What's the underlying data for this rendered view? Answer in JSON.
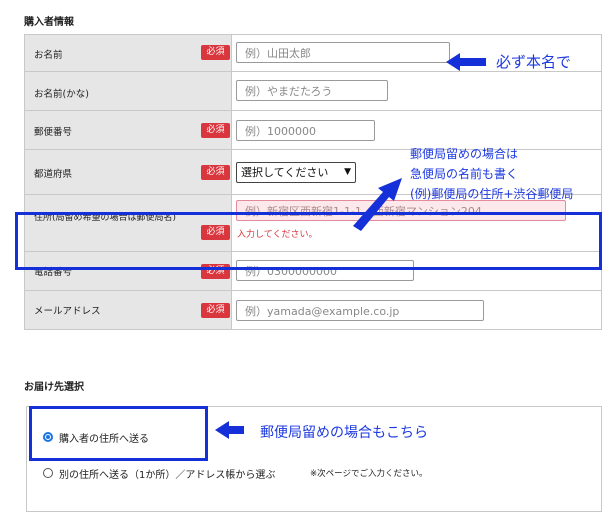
{
  "colors": {
    "required_badge": "#d9363e",
    "annotation": "#1d39e0",
    "label_bg": "#e6e6e6",
    "radio_selected": "#1a73e8"
  },
  "buyer_section": {
    "title": "購入者情報",
    "required_label": "必須",
    "fields": [
      {
        "label": "お名前",
        "required": true,
        "placeholder": "例）山田太郎"
      },
      {
        "label": "お名前(かな)",
        "required": false,
        "placeholder": "例）やまだたろう"
      },
      {
        "label": "郵便番号",
        "required": true,
        "placeholder": "例）1000000"
      },
      {
        "label": "都道府県",
        "required": true,
        "select_value": "選択してください"
      },
      {
        "label": "住所(局留め希望の場合は郵便局名)",
        "required": true,
        "placeholder": "例）新宿区西新宿1-1-1　西新宿マンション204",
        "error": "入力してください。"
      },
      {
        "label": "電話番号",
        "required": true,
        "placeholder": "例）0300000000"
      },
      {
        "label": "メールアドレス",
        "required": true,
        "placeholder": "例）yamada@example.co.jp"
      }
    ]
  },
  "shipping_section": {
    "title": "お届け先選択",
    "options": [
      {
        "label": "購入者の住所へ送る",
        "selected": true
      },
      {
        "label": "別の住所へ送る（1か所）／アドレス帳から選ぶ",
        "selected": false,
        "note": "※次ページでご入力ください。"
      }
    ]
  },
  "annotations": {
    "name_note": "必ず本名で",
    "post_office_line1": "郵便局留めの場合は",
    "post_office_line2": "急便局の名前も書く",
    "post_office_line3": "(例)郵便局の住所+渋谷郵便局",
    "shipping_note": "郵便局留めの場合もこちら"
  }
}
